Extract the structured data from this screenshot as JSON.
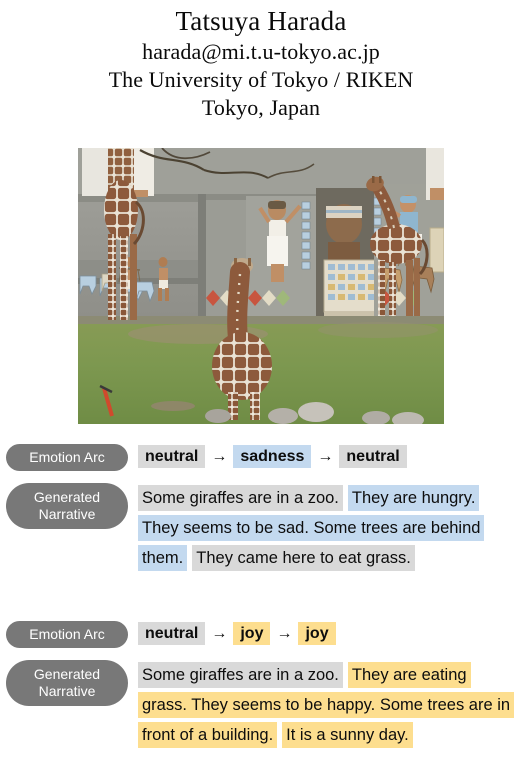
{
  "header": {
    "name": "Tatsuya Harada",
    "email": "harada@mi.t.u-tokyo.ac.jp",
    "affiliation": "The University of Tokyo / RIKEN",
    "location": "Tokyo, Japan"
  },
  "photo": {
    "alt": "Giraffes standing on grass in front of an Egyptian-themed zoo enclosure wall with painted murals",
    "colors": {
      "grass": "#7f9a4e",
      "wall": "#9a9a95",
      "giraffe_body": "#8d5a3c",
      "giraffe_pattern": "#e8e0d2",
      "sky_trim": "#cfd4cd"
    }
  },
  "colors": {
    "pill_background": "#787878",
    "pill_text": "#ffffff",
    "neutral_highlight": "#d9d9d9",
    "sadness_highlight": "#c3d9ef",
    "joy_highlight": "#fdde8f",
    "text": "#0d0d0d"
  },
  "blocks": [
    {
      "arc_label": "Emotion Arc",
      "narrative_label_line1": "Generated",
      "narrative_label_line2": "Narrative",
      "arrow": "→",
      "arc": [
        {
          "text": "neutral",
          "emotion": "neutral"
        },
        {
          "text": "sadness",
          "emotion": "sadness"
        },
        {
          "text": "neutral",
          "emotion": "neutral"
        }
      ],
      "narrative": [
        {
          "text": "Some giraffes are in a zoo.",
          "emotion": "neutral"
        },
        {
          "text": "They are hungry. They seems to be sad. Some trees are behind them.",
          "emotion": "sadness"
        },
        {
          "text": "They came here to eat grass.",
          "emotion": "neutral"
        }
      ]
    },
    {
      "arc_label": "Emotion Arc",
      "narrative_label_line1": "Generated",
      "narrative_label_line2": "Narrative",
      "arrow": "→",
      "arc": [
        {
          "text": "neutral",
          "emotion": "neutral"
        },
        {
          "text": "joy",
          "emotion": "joy"
        },
        {
          "text": "joy",
          "emotion": "joy"
        }
      ],
      "narrative": [
        {
          "text": "Some giraffes are in a zoo.",
          "emotion": "neutral"
        },
        {
          "text": "They are eating grass. They seems to be happy. Some trees are in front of a building.",
          "emotion": "joy"
        },
        {
          "text": "It is a sunny day.",
          "emotion": "joy"
        }
      ]
    }
  ]
}
